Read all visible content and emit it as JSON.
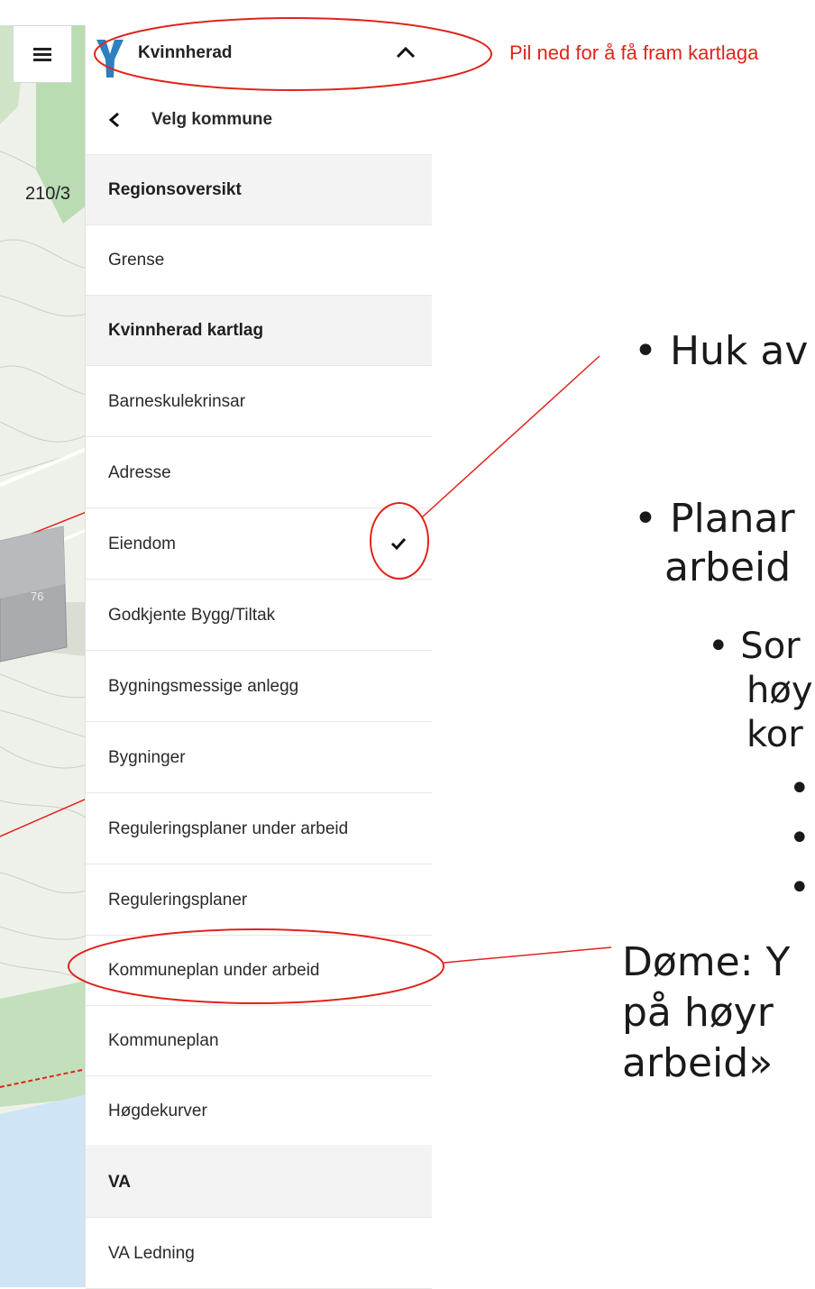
{
  "map": {
    "lot_label": "210/3",
    "building_label": "76"
  },
  "panel": {
    "kommune_name": "Kvinnherad",
    "back_label": "Velg kommune",
    "rows": [
      {
        "label": "Regionsoversikt",
        "type": "section"
      },
      {
        "label": "Grense",
        "type": "item"
      },
      {
        "label": "Kvinnherad kartlag",
        "type": "section"
      },
      {
        "label": "Barneskulekrinsar",
        "type": "item"
      },
      {
        "label": "Adresse",
        "type": "item"
      },
      {
        "label": "Eiendom",
        "type": "item",
        "checked": true
      },
      {
        "label": "Godkjente Bygg/Tiltak",
        "type": "item"
      },
      {
        "label": "Bygningsmessige anlegg",
        "type": "item"
      },
      {
        "label": "Bygninger",
        "type": "item"
      },
      {
        "label": "Reguleringsplaner under arbeid",
        "type": "item"
      },
      {
        "label": "Reguleringsplaner",
        "type": "item"
      },
      {
        "label": "Kommuneplan under arbeid",
        "type": "item"
      },
      {
        "label": "Kommuneplan",
        "type": "item"
      },
      {
        "label": "Høgdekurver",
        "type": "item"
      },
      {
        "label": "VA",
        "type": "section"
      },
      {
        "label": "VA Ledning",
        "type": "item"
      }
    ]
  },
  "annotation": {
    "text": "Pil ned for å få fram kartlaga",
    "color": "#e0241b"
  },
  "slide": {
    "bullet_1": "• Huk av",
    "bullet_2_line_1": "• Planar",
    "bullet_2_line_2": "arbeid",
    "bullet_3_line_1": "• Sor",
    "bullet_3_line_2": "høy",
    "bullet_3_line_3": "kor",
    "bullet_4": "•",
    "bullet_5": "•",
    "bullet_6": "•",
    "example_line_1": "Døme: Y",
    "example_line_2": "på høyr",
    "example_line_3": "arbeid»"
  }
}
